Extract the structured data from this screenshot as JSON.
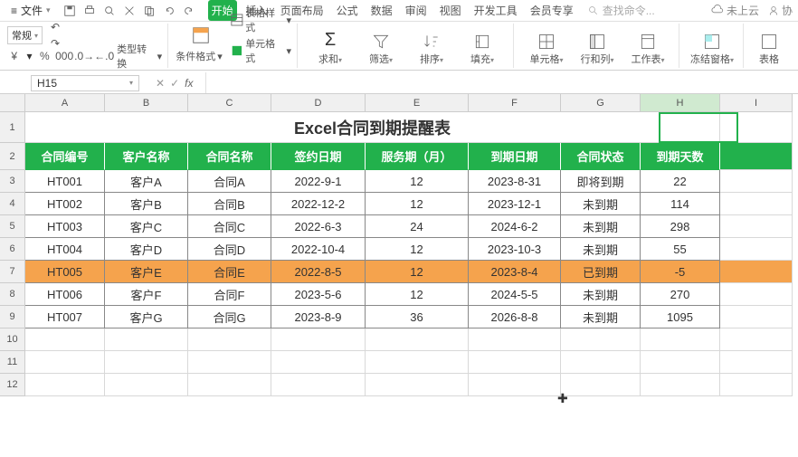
{
  "menubar": {
    "file": "文件",
    "tabs": [
      "开始",
      "插入",
      "页面布局",
      "公式",
      "数据",
      "审阅",
      "视图",
      "开发工具",
      "会员专享"
    ],
    "activeTab": 0,
    "searchPlaceholder": "查找命令...",
    "cloudStatus": "未上云",
    "coop": "协"
  },
  "ribbon": {
    "numberFormat": "常规",
    "typeConvert": "类型转换",
    "condFormat": "条件格式",
    "tableStyle": "表格样式",
    "cellStyle": "单元格式",
    "sum": "求和",
    "filter": "筛选",
    "sort": "排序",
    "fill": "填充",
    "cell": "单元格",
    "rowcol": "行和列",
    "sheet": "工作表",
    "freeze": "冻结窗格",
    "tableOps": "表格"
  },
  "fxbar": {
    "cellRef": "H15"
  },
  "sheet": {
    "cols": [
      "A",
      "B",
      "C",
      "D",
      "E",
      "F",
      "G",
      "H",
      "I"
    ],
    "title": "Excel合同到期提醒表",
    "headers": [
      "合同编号",
      "客户名称",
      "合同名称",
      "签约日期",
      "服务期（月）",
      "到期日期",
      "合同状态",
      "到期天数"
    ],
    "rows": [
      {
        "no": "HT001",
        "cust": "客户A",
        "name": "合同A",
        "sign": "2022-9-1",
        "months": "12",
        "due": "2023-8-31",
        "status": "即将到期",
        "days": "22",
        "hl": false
      },
      {
        "no": "HT002",
        "cust": "客户B",
        "name": "合同B",
        "sign": "2022-12-2",
        "months": "12",
        "due": "2023-12-1",
        "status": "未到期",
        "days": "114",
        "hl": false
      },
      {
        "no": "HT003",
        "cust": "客户C",
        "name": "合同C",
        "sign": "2022-6-3",
        "months": "24",
        "due": "2024-6-2",
        "status": "未到期",
        "days": "298",
        "hl": false
      },
      {
        "no": "HT004",
        "cust": "客户D",
        "name": "合同D",
        "sign": "2022-10-4",
        "months": "12",
        "due": "2023-10-3",
        "status": "未到期",
        "days": "55",
        "hl": false
      },
      {
        "no": "HT005",
        "cust": "客户E",
        "name": "合同E",
        "sign": "2022-8-5",
        "months": "12",
        "due": "2023-8-4",
        "status": "已到期",
        "days": "-5",
        "hl": true
      },
      {
        "no": "HT006",
        "cust": "客户F",
        "name": "合同F",
        "sign": "2023-5-6",
        "months": "12",
        "due": "2024-5-5",
        "status": "未到期",
        "days": "270",
        "hl": false
      },
      {
        "no": "HT007",
        "cust": "客户G",
        "name": "合同G",
        "sign": "2023-8-9",
        "months": "36",
        "due": "2026-8-8",
        "status": "未到期",
        "days": "1095",
        "hl": false
      }
    ],
    "emptyRows": 3
  }
}
